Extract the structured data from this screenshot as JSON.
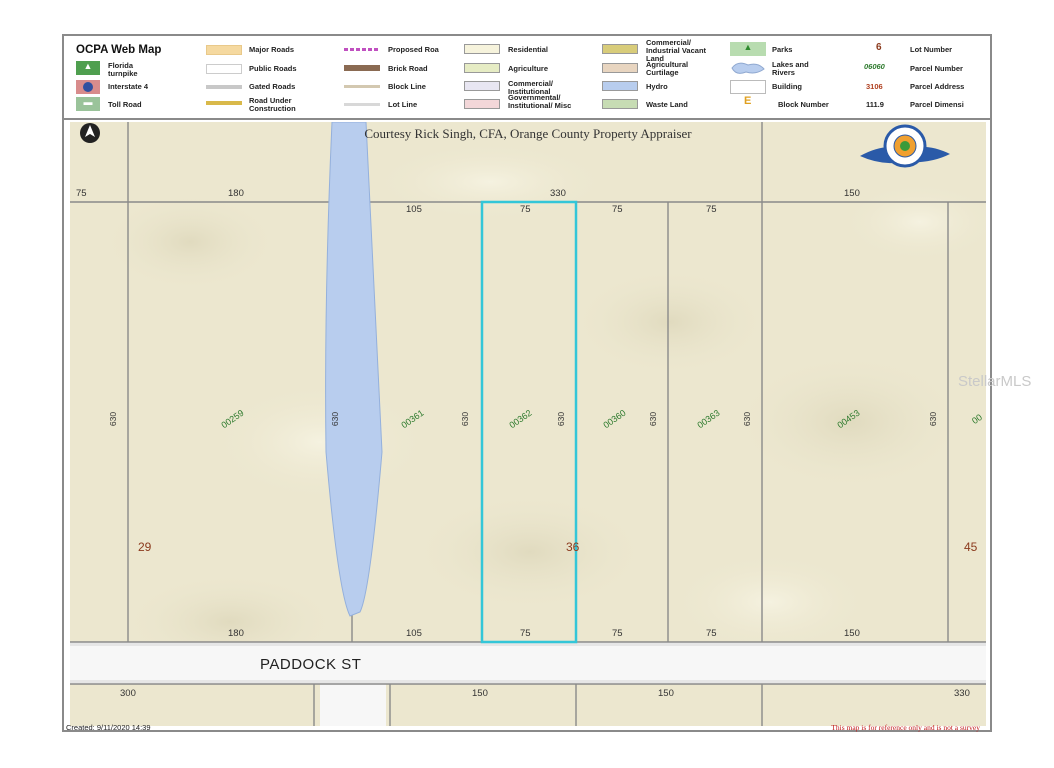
{
  "legend": {
    "title": "OCPA Web Map",
    "items": [
      {
        "label": "Florida turnpike"
      },
      {
        "label": "Interstate 4"
      },
      {
        "label": "Toll Road"
      },
      {
        "label": "Major Roads"
      },
      {
        "label": "Public Roads"
      },
      {
        "label": "Gated Roads"
      },
      {
        "label": "Road Under Construction"
      },
      {
        "label": "Proposed Roa"
      },
      {
        "label": "Brick Road"
      },
      {
        "label": "Block Line"
      },
      {
        "label": "Lot Line"
      },
      {
        "label": "Residential"
      },
      {
        "label": "Agriculture"
      },
      {
        "label": "Commercial/ Institutional"
      },
      {
        "label": "Governmental/ Institutional/ Misc"
      },
      {
        "label": "Commercial/ Industrial Vacant Land"
      },
      {
        "label": "Agricultural Curtilage"
      },
      {
        "label": "Hydro"
      },
      {
        "label": "Waste Land"
      },
      {
        "label": "Parks"
      },
      {
        "label": "Lakes and Rivers"
      },
      {
        "label": "Building"
      },
      {
        "label": "Block Number"
      },
      {
        "label": "Lot Number"
      },
      {
        "label": "Parcel Number"
      },
      {
        "label": "Parcel Address"
      },
      {
        "label": "Parcel Dimensi"
      }
    ],
    "samples": {
      "lot": "6",
      "parcel": "06060",
      "address": "3106",
      "dimension": "111.9",
      "block": "E"
    },
    "colors": {
      "major_roads": "#f5d9a0",
      "residential": "#f6f3dc",
      "agriculture": "#e6ecc4",
      "commercial": "#e8e6f2",
      "governmental": "#f3d7d9",
      "vacant": "#d8cc7a",
      "curtilage": "#e8d5c0",
      "hydro": "#b8cdee",
      "waste": "#c7dcb4",
      "parks": "#7fc07f"
    }
  },
  "map": {
    "courtesy": "Courtesy Rick Singh, CFA, Orange County Property Appraiser",
    "seal_text": "RICK SINGH CFA",
    "top_dims": [
      "75",
      "180",
      "330",
      "150"
    ],
    "lot_top_dims": [
      "105",
      "75",
      "75",
      "75"
    ],
    "side_dims": [
      "630",
      "630",
      "630",
      "630",
      "630",
      "630",
      "630"
    ],
    "parcels": [
      "00259",
      "00361",
      "00362",
      "00360",
      "00363",
      "00453",
      "00"
    ],
    "lot_numbers": [
      "29",
      "36",
      "45"
    ],
    "bottom_dims": [
      "180",
      "105",
      "75",
      "75",
      "75",
      "150"
    ],
    "street": "PADDOCK ST",
    "south_dims": [
      "300",
      "150",
      "150",
      "330"
    ],
    "created": "Created: 9/11/2020 14:39",
    "disclaimer": "This map is for reference only and is not a survey",
    "colors": {
      "land": "#ece7cf",
      "highlight": "#33c6d8",
      "hydro": "#b8cdee",
      "lot_line": "#8a8a8a"
    }
  },
  "watermark": "StellarMLS"
}
